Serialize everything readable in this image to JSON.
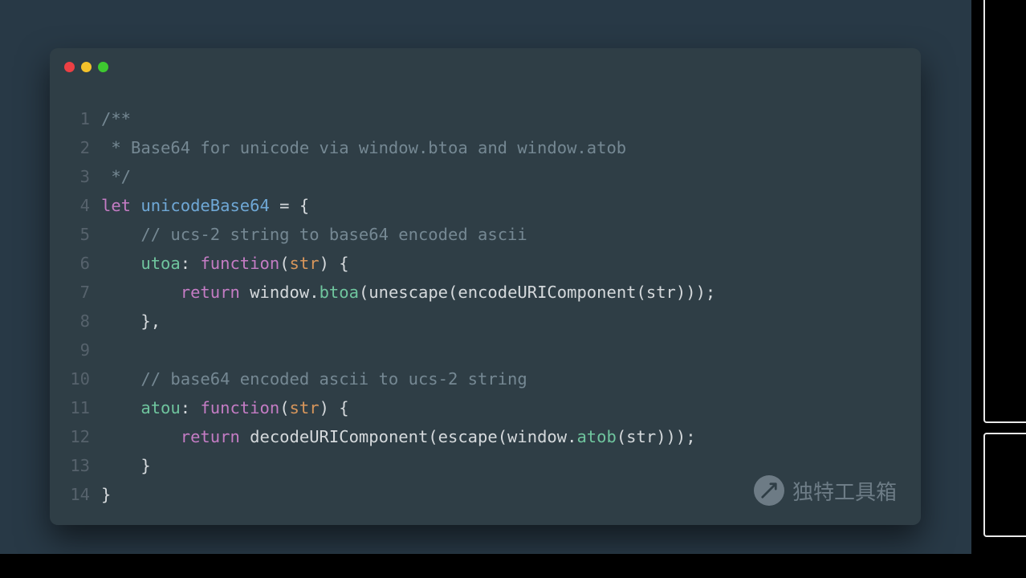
{
  "window": {
    "traffic_lights": [
      "red",
      "yellow",
      "green"
    ]
  },
  "watermark": {
    "text": "独特工具箱"
  },
  "code": {
    "lines": [
      {
        "n": "1",
        "tokens": [
          {
            "t": "/**",
            "c": "tok-comment"
          }
        ]
      },
      {
        "n": "2",
        "tokens": [
          {
            "t": " * Base64 for unicode via window.btoa and window.atob",
            "c": "tok-comment"
          }
        ]
      },
      {
        "n": "3",
        "tokens": [
          {
            "t": " */",
            "c": "tok-comment"
          }
        ]
      },
      {
        "n": "4",
        "tokens": [
          {
            "t": "let ",
            "c": "tok-key"
          },
          {
            "t": "unicodeBase64",
            "c": "tok-decl"
          },
          {
            "t": " = {",
            "c": "tok-plain"
          }
        ]
      },
      {
        "n": "5",
        "tokens": [
          {
            "t": "    ",
            "c": "tok-plain"
          },
          {
            "t": "// ucs-2 string to base64 encoded ascii",
            "c": "tok-comment"
          }
        ]
      },
      {
        "n": "6",
        "tokens": [
          {
            "t": "    ",
            "c": "tok-plain"
          },
          {
            "t": "utoa",
            "c": "tok-prop"
          },
          {
            "t": ": ",
            "c": "tok-plain"
          },
          {
            "t": "function",
            "c": "tok-func"
          },
          {
            "t": "(",
            "c": "tok-plain"
          },
          {
            "t": "str",
            "c": "tok-param"
          },
          {
            "t": ") {",
            "c": "tok-plain"
          }
        ]
      },
      {
        "n": "7",
        "tokens": [
          {
            "t": "        ",
            "c": "tok-plain"
          },
          {
            "t": "return",
            "c": "tok-key"
          },
          {
            "t": " window.",
            "c": "tok-plain"
          },
          {
            "t": "btoa",
            "c": "tok-prop"
          },
          {
            "t": "(unescape(encodeURIComponent(str)));",
            "c": "tok-plain"
          }
        ]
      },
      {
        "n": "8",
        "tokens": [
          {
            "t": "    },",
            "c": "tok-plain"
          }
        ]
      },
      {
        "n": "9",
        "tokens": [
          {
            "t": "",
            "c": "tok-plain"
          }
        ]
      },
      {
        "n": "10",
        "tokens": [
          {
            "t": "    ",
            "c": "tok-plain"
          },
          {
            "t": "// base64 encoded ascii to ucs-2 string",
            "c": "tok-comment"
          }
        ]
      },
      {
        "n": "11",
        "tokens": [
          {
            "t": "    ",
            "c": "tok-plain"
          },
          {
            "t": "atou",
            "c": "tok-prop"
          },
          {
            "t": ": ",
            "c": "tok-plain"
          },
          {
            "t": "function",
            "c": "tok-func"
          },
          {
            "t": "(",
            "c": "tok-plain"
          },
          {
            "t": "str",
            "c": "tok-param"
          },
          {
            "t": ") {",
            "c": "tok-plain"
          }
        ]
      },
      {
        "n": "12",
        "tokens": [
          {
            "t": "        ",
            "c": "tok-plain"
          },
          {
            "t": "return",
            "c": "tok-key"
          },
          {
            "t": " decodeURIComponent(escape(window.",
            "c": "tok-plain"
          },
          {
            "t": "atob",
            "c": "tok-prop"
          },
          {
            "t": "(str)));",
            "c": "tok-plain"
          }
        ]
      },
      {
        "n": "13",
        "tokens": [
          {
            "t": "    }",
            "c": "tok-plain"
          }
        ]
      },
      {
        "n": "14",
        "tokens": [
          {
            "t": "}",
            "c": "tok-plain"
          }
        ]
      }
    ]
  }
}
